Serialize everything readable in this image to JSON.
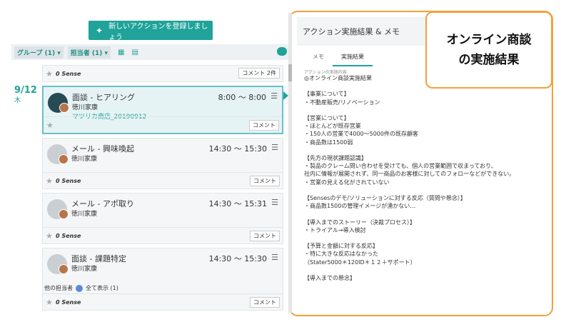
{
  "toolbar": {
    "new_action_label": "新しいアクションを登録しましょう"
  },
  "filters": {
    "group": "グループ (1) ▾",
    "owner": "担当者 (1) ▾"
  },
  "date": {
    "day": "9/12",
    "weekday": "木"
  },
  "top_row": {
    "sense": "0 Sense",
    "comment": "コメント 2件"
  },
  "activities": [
    {
      "title": "面談 - ヒアリング",
      "time": "8:00 〜 8:00",
      "person": "徳川家康",
      "company": "マツリカ商店_20190912",
      "sense": "",
      "comment": "コメント"
    },
    {
      "title": "メール - 興味喚起",
      "time": "14:30 〜 15:30",
      "person": "徳川家康",
      "company": "",
      "sense": "0 Sense",
      "comment": "コメント"
    },
    {
      "title": "メール - アポ取り",
      "time": "14:30 〜 15:31",
      "person": "徳川家康",
      "company": "",
      "sense": "0 Sense",
      "comment": "コメント"
    },
    {
      "title": "面談 - 課題特定",
      "time": "14:30 〜 15:30",
      "person": "徳川家康",
      "company": "",
      "sense": "0 Sense",
      "comment": "コメント"
    }
  ],
  "other_owner": {
    "label": "他の担当者",
    "show_all": "全て表示 (1)"
  },
  "panel": {
    "title": "アクション実施結果 & メモ",
    "tabs": [
      "メモ",
      "実施結果"
    ],
    "section_label": "アクションの実施内容",
    "content": "◎オンライン商談実施結果\n\n【事業について】\n・不動産販売/リノベーション\n\n【営業について】\n・ほとんどが既存営業\n・150人の営業で4000〜5000件の既存顧客\n・商品数は1500弱\n\n【先方の現状課題認識】\n・製品のクレーム問い合わせを受けても、個人の営業範囲で収まっており、\n社内に情報が展開されず、同一商品のお客様に対してのフォローなどができない。\n・営業の見える化がされていない\n\n【Sensesのデモ/ソリューションに対する反応（質問や懸念）】\n・商品数1500の管理イメージが湧かない…\n\n【導入までのストーリー（決裁プロセス）】\n・トライアル→導入検討\n\n【予算と金額に対する反応】\n・特に大きな反応はなかった\n（Stater5000＊120ID＊１２＋サポート）\n\n【導入までの懸念】"
  },
  "callout": {
    "line1": "オンライン商談",
    "line2": "の実施結果"
  },
  "colors": {
    "accent": "#1fa39a",
    "callout_border": "#f0a23a"
  }
}
